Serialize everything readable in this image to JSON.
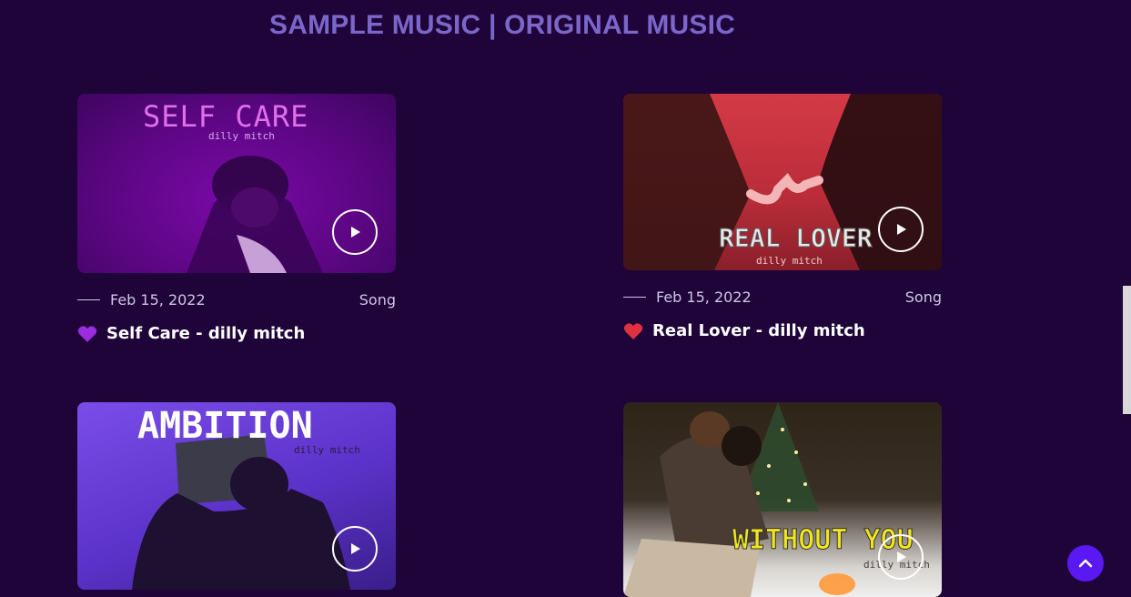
{
  "page": {
    "heading": "SAMPLE MUSIC | ORIGINAL MUSIC"
  },
  "posts": [
    {
      "art_title": "SELF CARE",
      "art_subtitle": "dilly mitch",
      "date": "Feb 15, 2022",
      "category": "Song",
      "emoji": "purple-heart-icon",
      "title": "Self Care - dilly mitch",
      "accent": "#9b2ce0"
    },
    {
      "art_title": "REAL LOVER",
      "art_subtitle": "dilly mitch",
      "date": "Feb 15, 2022",
      "category": "Song",
      "emoji": "red-heart-icon",
      "title": "Real Lover - dilly mitch",
      "accent": "#e0313f"
    },
    {
      "art_title": "AMBITION",
      "art_subtitle": "dilly mitch",
      "accent": "#6b3fd6"
    },
    {
      "art_title": "WITHOUT YOU",
      "art_subtitle": "dilly mitch",
      "accent": "#f2e61b"
    }
  ],
  "colors": {
    "background": "#1e0439",
    "heading": "#7b66c9",
    "scroll_to_top": "#5a18f2"
  },
  "icons": {
    "play": "play-icon",
    "scroll_top": "chevron-up-icon"
  }
}
